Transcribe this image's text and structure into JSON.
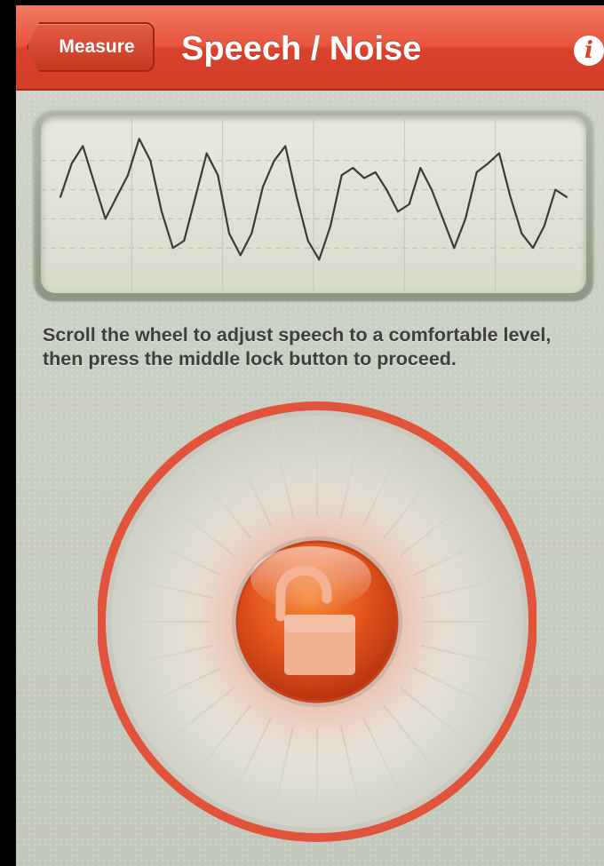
{
  "nav": {
    "back_label": "Measure",
    "title": "Speech / Noise",
    "info_icon": "info-icon"
  },
  "waveform": {
    "grid_rows": 4,
    "grid_cols": 6,
    "samples": [
      0.55,
      0.78,
      0.9,
      0.65,
      0.4,
      0.55,
      0.7,
      0.95,
      0.8,
      0.45,
      0.2,
      0.25,
      0.55,
      0.85,
      0.7,
      0.3,
      0.15,
      0.3,
      0.62,
      0.8,
      0.9,
      0.55,
      0.25,
      0.12,
      0.35,
      0.7,
      0.75,
      0.68,
      0.72,
      0.6,
      0.45,
      0.5,
      0.75,
      0.6,
      0.4,
      0.2,
      0.4,
      0.72,
      0.78,
      0.85,
      0.55,
      0.3,
      0.2,
      0.35,
      0.6,
      0.55
    ]
  },
  "instruction": "Scroll the wheel to adjust speech to a comfortable level, then press the middle lock button to proceed.",
  "wheel": {
    "lock_state": "unlocked",
    "lock_icon": "unlocked-padlock-icon",
    "accent_color": "#e2533b",
    "lock_color": "#e04a1c"
  }
}
